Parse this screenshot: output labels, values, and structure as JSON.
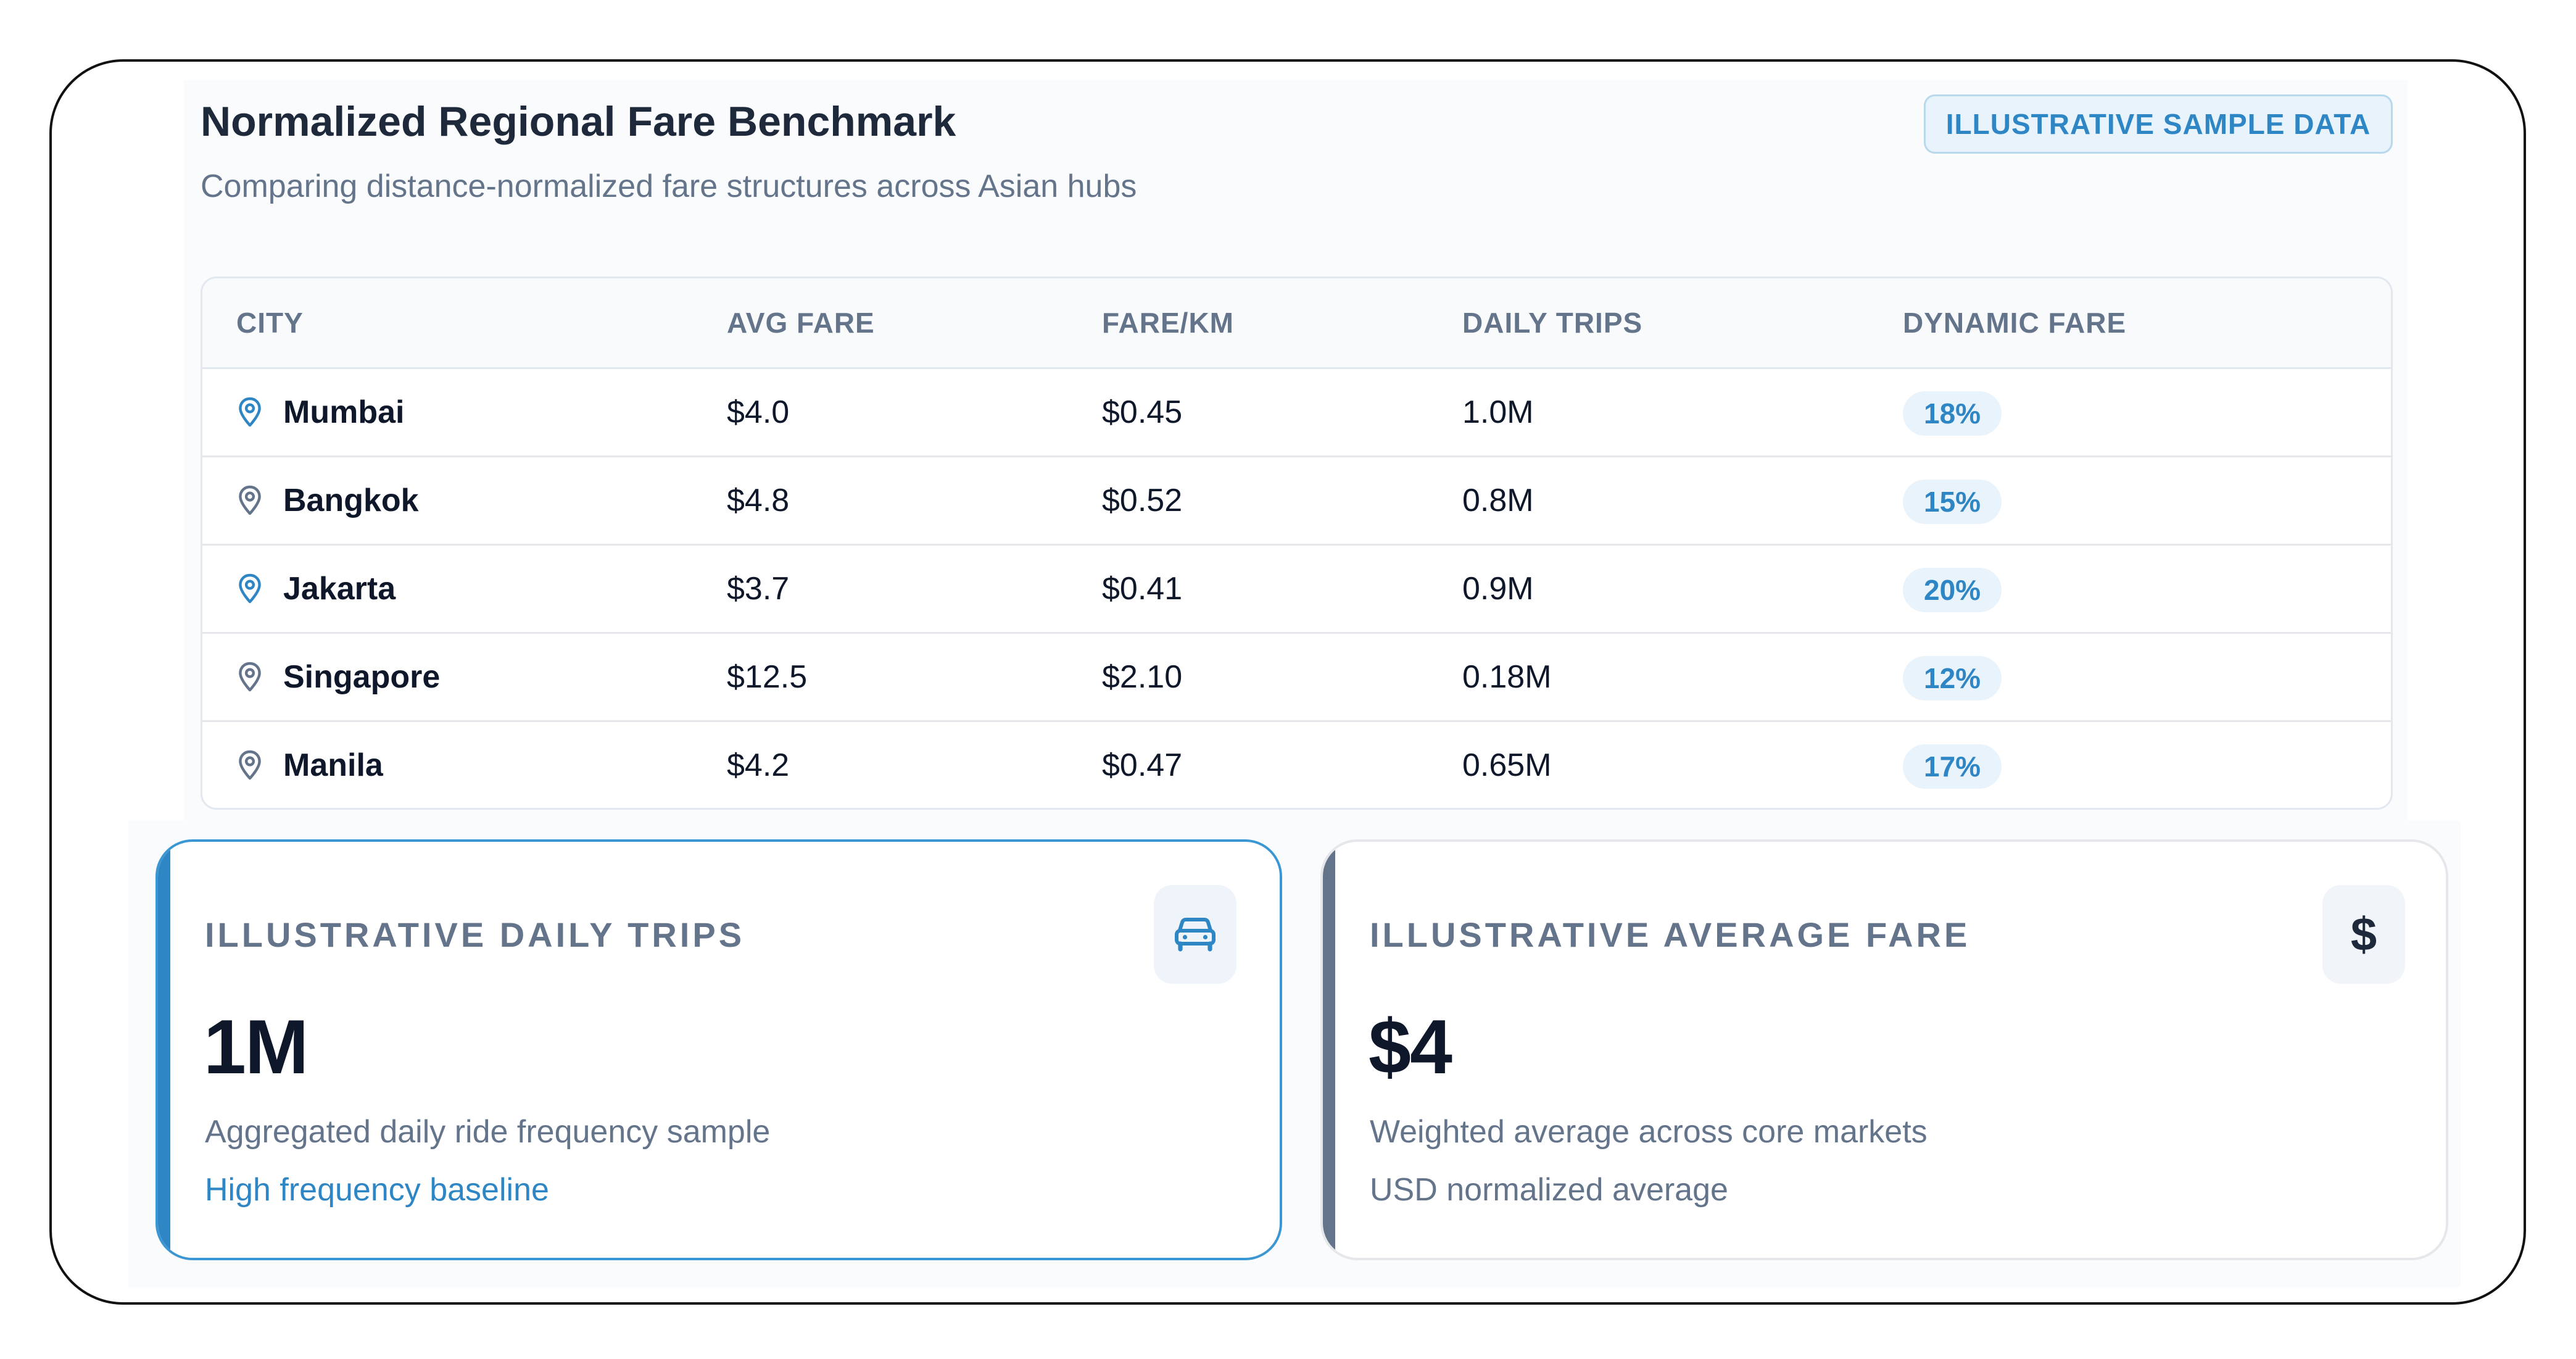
{
  "header": {
    "title": "Normalized Regional Fare Benchmark",
    "subtitle": "Comparing distance-normalized fare structures across Asian hubs",
    "badge": "ILLUSTRATIVE SAMPLE DATA"
  },
  "table": {
    "columns": [
      "CITY",
      "AVG FARE",
      "FARE/KM",
      "DAILY TRIPS",
      "DYNAMIC FARE"
    ],
    "rows": [
      {
        "city": "Mumbai",
        "avg_fare": "$4.0",
        "fare_km": "$0.45",
        "daily_trips": "1.0M",
        "dynamic_fare": "18%",
        "pin_color": "#2f86c4"
      },
      {
        "city": "Bangkok",
        "avg_fare": "$4.8",
        "fare_km": "$0.52",
        "daily_trips": "0.8M",
        "dynamic_fare": "15%",
        "pin_color": "#64748b"
      },
      {
        "city": "Jakarta",
        "avg_fare": "$3.7",
        "fare_km": "$0.41",
        "daily_trips": "0.9M",
        "dynamic_fare": "20%",
        "pin_color": "#2f86c4"
      },
      {
        "city": "Singapore",
        "avg_fare": "$12.5",
        "fare_km": "$2.10",
        "daily_trips": "0.18M",
        "dynamic_fare": "12%",
        "pin_color": "#64748b"
      },
      {
        "city": "Manila",
        "avg_fare": "$4.2",
        "fare_km": "$0.47",
        "daily_trips": "0.65M",
        "dynamic_fare": "17%",
        "pin_color": "#64748b"
      }
    ]
  },
  "cards": [
    {
      "label": "ILLUSTRATIVE DAILY TRIPS",
      "value": "1M",
      "description": "Aggregated daily ride frequency sample",
      "note": "High frequency baseline",
      "icon": "car-icon",
      "accent_color": "#2f86c4"
    },
    {
      "label": "ILLUSTRATIVE AVERAGE FARE",
      "value": "$4",
      "description": "Weighted average across core markets",
      "note": "USD normalized average",
      "icon": "dollar-icon",
      "icon_glyph": "$",
      "accent_color": "#64748b"
    }
  ]
}
